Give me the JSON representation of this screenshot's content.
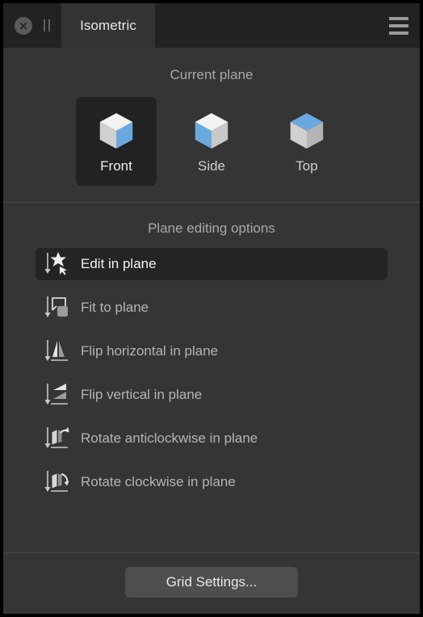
{
  "window": {
    "tab_label": "Isometric",
    "close_icon": "close-circle-icon",
    "pause_icon": "pause-bars-icon",
    "menu_icon": "hamburger-menu-icon"
  },
  "plane_section": {
    "title": "Current plane",
    "selected": "Front",
    "items": [
      {
        "label": "Front",
        "icon": "cube-front-icon",
        "selected": true,
        "top": "#f2f2f2",
        "left": "#d0d0d0",
        "right": "#6aa9e0"
      },
      {
        "label": "Side",
        "icon": "cube-side-icon",
        "selected": false,
        "top": "#f2f2f2",
        "left": "#6aa9e0",
        "right": "#c8c8c8"
      },
      {
        "label": "Top",
        "icon": "cube-top-icon",
        "selected": false,
        "top": "#6aa9e0",
        "left": "#d0d0d0",
        "right": "#b4b4b4"
      }
    ]
  },
  "options_section": {
    "title": "Plane editing options",
    "items": [
      {
        "label": "Edit in plane",
        "icon": "edit-in-plane-icon",
        "active": true
      },
      {
        "label": "Fit to plane",
        "icon": "fit-to-plane-icon",
        "active": false
      },
      {
        "label": "Flip horizontal in plane",
        "icon": "flip-horizontal-icon",
        "active": false
      },
      {
        "label": "Flip vertical in plane",
        "icon": "flip-vertical-icon",
        "active": false
      },
      {
        "label": "Rotate anticlockwise in plane",
        "icon": "rotate-anticlockwise-icon",
        "active": false
      },
      {
        "label": "Rotate clockwise in plane",
        "icon": "rotate-clockwise-icon",
        "active": false
      }
    ]
  },
  "footer": {
    "grid_settings_label": "Grid Settings..."
  },
  "colors": {
    "accent_blue": "#6aa9e0",
    "panel_bg": "#353535",
    "titlebar_bg": "#222222",
    "tab_bg": "#333333",
    "selected_bg": "#222222",
    "divider": "#4a4a4a",
    "button_bg": "#4e4e4e"
  }
}
